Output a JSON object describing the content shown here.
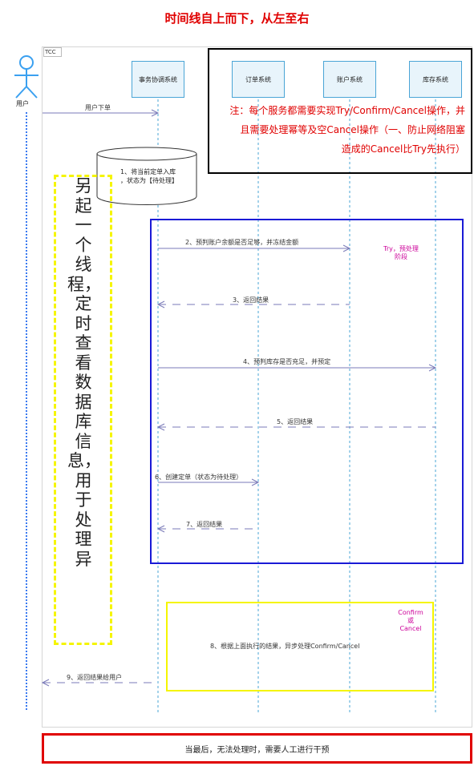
{
  "header": {
    "title": "时间线自上而下，从左至右"
  },
  "frame": {
    "tab_label": "TCC"
  },
  "actor": {
    "label": "用户"
  },
  "participants": [
    {
      "id": "coordinator",
      "label": "事务协调系统"
    },
    {
      "id": "order",
      "label": "订单系统"
    },
    {
      "id": "account",
      "label": "账户系统"
    },
    {
      "id": "stock",
      "label": "库存系统"
    }
  ],
  "notes": {
    "tcc_note": [
      "注：每个服务都需要实现Try/Confirm/Cancel操作，并",
      "且需要处理幂等及空Cancel操作（一、防止网络阻塞",
      "造成的Cancel比Try先执行）"
    ],
    "db_note": [
      "1、将当前定单入库",
      "，状态为【待处理】"
    ],
    "thread_note": "另起一个线程，定时查看数据库信息，用于处理异",
    "try_phase": [
      "Try，预处理",
      "阶段"
    ],
    "confirm_phase": [
      "Confirm",
      "或",
      "Cancel"
    ],
    "manual": "当最后，无法处理时，需要人工进行干预"
  },
  "messages": {
    "m0": "用户下单",
    "m2": "2、预判账户余额是否足够，并冻结金额",
    "m3": "3、返回结果",
    "m4": "4、预判库存是否充足，并预定",
    "m5": "5、返回结果",
    "m6": "6、创建定单（状态为待处理）",
    "m7": "7、返回结果",
    "m8": "8、根据上面执行的结果，异步处理Confirm/Cancel",
    "m9": "9、返回结果给用户"
  },
  "colors": {
    "lifeline": "#4aa5d6",
    "actor": "#3aa0f0",
    "arrow": "#7a7ab8",
    "note_red": "#e00000",
    "frame_blue": "#1a1ad6",
    "frame_yellow": "#f5f500"
  }
}
